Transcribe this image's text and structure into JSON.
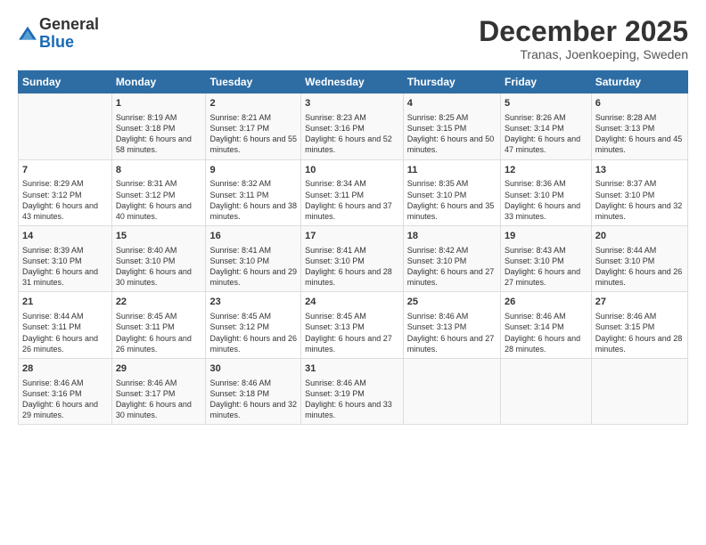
{
  "logo": {
    "general": "General",
    "blue": "Blue"
  },
  "title": "December 2025",
  "location": "Tranas, Joenkoeping, Sweden",
  "days_header": [
    "Sunday",
    "Monday",
    "Tuesday",
    "Wednesday",
    "Thursday",
    "Friday",
    "Saturday"
  ],
  "weeks": [
    [
      {
        "day": "",
        "sunrise": "",
        "sunset": "",
        "daylight": ""
      },
      {
        "day": "1",
        "sunrise": "Sunrise: 8:19 AM",
        "sunset": "Sunset: 3:18 PM",
        "daylight": "Daylight: 6 hours and 58 minutes."
      },
      {
        "day": "2",
        "sunrise": "Sunrise: 8:21 AM",
        "sunset": "Sunset: 3:17 PM",
        "daylight": "Daylight: 6 hours and 55 minutes."
      },
      {
        "day": "3",
        "sunrise": "Sunrise: 8:23 AM",
        "sunset": "Sunset: 3:16 PM",
        "daylight": "Daylight: 6 hours and 52 minutes."
      },
      {
        "day": "4",
        "sunrise": "Sunrise: 8:25 AM",
        "sunset": "Sunset: 3:15 PM",
        "daylight": "Daylight: 6 hours and 50 minutes."
      },
      {
        "day": "5",
        "sunrise": "Sunrise: 8:26 AM",
        "sunset": "Sunset: 3:14 PM",
        "daylight": "Daylight: 6 hours and 47 minutes."
      },
      {
        "day": "6",
        "sunrise": "Sunrise: 8:28 AM",
        "sunset": "Sunset: 3:13 PM",
        "daylight": "Daylight: 6 hours and 45 minutes."
      }
    ],
    [
      {
        "day": "7",
        "sunrise": "Sunrise: 8:29 AM",
        "sunset": "Sunset: 3:12 PM",
        "daylight": "Daylight: 6 hours and 43 minutes."
      },
      {
        "day": "8",
        "sunrise": "Sunrise: 8:31 AM",
        "sunset": "Sunset: 3:12 PM",
        "daylight": "Daylight: 6 hours and 40 minutes."
      },
      {
        "day": "9",
        "sunrise": "Sunrise: 8:32 AM",
        "sunset": "Sunset: 3:11 PM",
        "daylight": "Daylight: 6 hours and 38 minutes."
      },
      {
        "day": "10",
        "sunrise": "Sunrise: 8:34 AM",
        "sunset": "Sunset: 3:11 PM",
        "daylight": "Daylight: 6 hours and 37 minutes."
      },
      {
        "day": "11",
        "sunrise": "Sunrise: 8:35 AM",
        "sunset": "Sunset: 3:10 PM",
        "daylight": "Daylight: 6 hours and 35 minutes."
      },
      {
        "day": "12",
        "sunrise": "Sunrise: 8:36 AM",
        "sunset": "Sunset: 3:10 PM",
        "daylight": "Daylight: 6 hours and 33 minutes."
      },
      {
        "day": "13",
        "sunrise": "Sunrise: 8:37 AM",
        "sunset": "Sunset: 3:10 PM",
        "daylight": "Daylight: 6 hours and 32 minutes."
      }
    ],
    [
      {
        "day": "14",
        "sunrise": "Sunrise: 8:39 AM",
        "sunset": "Sunset: 3:10 PM",
        "daylight": "Daylight: 6 hours and 31 minutes."
      },
      {
        "day": "15",
        "sunrise": "Sunrise: 8:40 AM",
        "sunset": "Sunset: 3:10 PM",
        "daylight": "Daylight: 6 hours and 30 minutes."
      },
      {
        "day": "16",
        "sunrise": "Sunrise: 8:41 AM",
        "sunset": "Sunset: 3:10 PM",
        "daylight": "Daylight: 6 hours and 29 minutes."
      },
      {
        "day": "17",
        "sunrise": "Sunrise: 8:41 AM",
        "sunset": "Sunset: 3:10 PM",
        "daylight": "Daylight: 6 hours and 28 minutes."
      },
      {
        "day": "18",
        "sunrise": "Sunrise: 8:42 AM",
        "sunset": "Sunset: 3:10 PM",
        "daylight": "Daylight: 6 hours and 27 minutes."
      },
      {
        "day": "19",
        "sunrise": "Sunrise: 8:43 AM",
        "sunset": "Sunset: 3:10 PM",
        "daylight": "Daylight: 6 hours and 27 minutes."
      },
      {
        "day": "20",
        "sunrise": "Sunrise: 8:44 AM",
        "sunset": "Sunset: 3:10 PM",
        "daylight": "Daylight: 6 hours and 26 minutes."
      }
    ],
    [
      {
        "day": "21",
        "sunrise": "Sunrise: 8:44 AM",
        "sunset": "Sunset: 3:11 PM",
        "daylight": "Daylight: 6 hours and 26 minutes."
      },
      {
        "day": "22",
        "sunrise": "Sunrise: 8:45 AM",
        "sunset": "Sunset: 3:11 PM",
        "daylight": "Daylight: 6 hours and 26 minutes."
      },
      {
        "day": "23",
        "sunrise": "Sunrise: 8:45 AM",
        "sunset": "Sunset: 3:12 PM",
        "daylight": "Daylight: 6 hours and 26 minutes."
      },
      {
        "day": "24",
        "sunrise": "Sunrise: 8:45 AM",
        "sunset": "Sunset: 3:13 PM",
        "daylight": "Daylight: 6 hours and 27 minutes."
      },
      {
        "day": "25",
        "sunrise": "Sunrise: 8:46 AM",
        "sunset": "Sunset: 3:13 PM",
        "daylight": "Daylight: 6 hours and 27 minutes."
      },
      {
        "day": "26",
        "sunrise": "Sunrise: 8:46 AM",
        "sunset": "Sunset: 3:14 PM",
        "daylight": "Daylight: 6 hours and 28 minutes."
      },
      {
        "day": "27",
        "sunrise": "Sunrise: 8:46 AM",
        "sunset": "Sunset: 3:15 PM",
        "daylight": "Daylight: 6 hours and 28 minutes."
      }
    ],
    [
      {
        "day": "28",
        "sunrise": "Sunrise: 8:46 AM",
        "sunset": "Sunset: 3:16 PM",
        "daylight": "Daylight: 6 hours and 29 minutes."
      },
      {
        "day": "29",
        "sunrise": "Sunrise: 8:46 AM",
        "sunset": "Sunset: 3:17 PM",
        "daylight": "Daylight: 6 hours and 30 minutes."
      },
      {
        "day": "30",
        "sunrise": "Sunrise: 8:46 AM",
        "sunset": "Sunset: 3:18 PM",
        "daylight": "Daylight: 6 hours and 32 minutes."
      },
      {
        "day": "31",
        "sunrise": "Sunrise: 8:46 AM",
        "sunset": "Sunset: 3:19 PM",
        "daylight": "Daylight: 6 hours and 33 minutes."
      },
      {
        "day": "",
        "sunrise": "",
        "sunset": "",
        "daylight": ""
      },
      {
        "day": "",
        "sunrise": "",
        "sunset": "",
        "daylight": ""
      },
      {
        "day": "",
        "sunrise": "",
        "sunset": "",
        "daylight": ""
      }
    ]
  ]
}
